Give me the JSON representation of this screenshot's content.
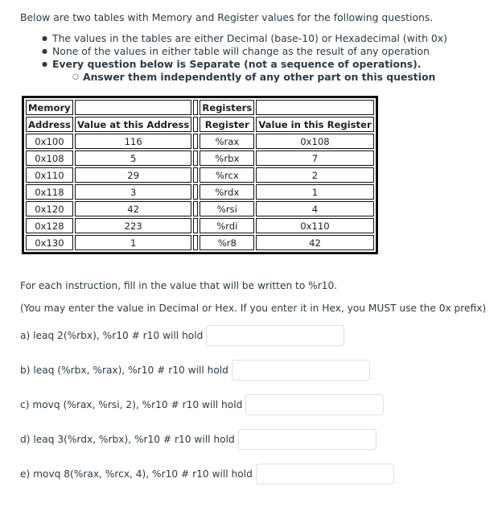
{
  "intro": "Below are two tables with Memory and Register values for the following questions.",
  "bullets": [
    "The values in the tables are either Decimal (base-10) or Hexadecimal (with 0x)",
    "None of the values in either table will change as the result of any operation",
    "Every question below is Separate (not a sequence of operations)."
  ],
  "sub_bullet": "Answer them independently of any other part on this question",
  "memory_table": {
    "title": "Memory",
    "headers": [
      "Address",
      "Value at this Address"
    ],
    "rows": [
      [
        "0x100",
        "116"
      ],
      [
        "0x108",
        "5"
      ],
      [
        "0x110",
        "29"
      ],
      [
        "0x118",
        "3"
      ],
      [
        "0x120",
        "42"
      ],
      [
        "0x128",
        "223"
      ],
      [
        "0x130",
        "1"
      ]
    ]
  },
  "register_table": {
    "title": "Registers",
    "headers": [
      "Register",
      "Value in this Register"
    ],
    "rows": [
      [
        "%rax",
        "0x108"
      ],
      [
        "%rbx",
        "7"
      ],
      [
        "%rcx",
        "2"
      ],
      [
        "%rdx",
        "1"
      ],
      [
        "%rsi",
        "4"
      ],
      [
        "%rdi",
        "0x110"
      ],
      [
        "%r8",
        "42"
      ]
    ]
  },
  "instructions_text": "For each instruction, fill in the value that will be written to %r10.",
  "hint_text": "(You may enter the value in Decimal or Hex.  If you enter it in Hex, you MUST use the 0x prefix)",
  "questions": [
    {
      "label": "a) leaq 2(%rbx), %r10 # r10 will hold",
      "value": ""
    },
    {
      "label": "b) leaq (%rbx, %rax), %r10 # r10 will hold",
      "value": ""
    },
    {
      "label": "c) movq (%rax, %rsi, 2), %r10 # r10 will hold",
      "value": ""
    },
    {
      "label": "d) leaq 3(%rdx, %rbx), %r10 # r10 will hold",
      "value": ""
    },
    {
      "label": "e) movq 8(%rax, %rcx, 4), %r10 # r10 will hold",
      "value": ""
    }
  ]
}
